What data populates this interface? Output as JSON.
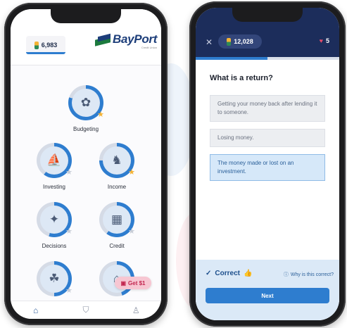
{
  "left_phone": {
    "header": {
      "coins": "6,983",
      "brand_name": "BayPort",
      "brand_sub": "Credit Union"
    },
    "topics": [
      {
        "label": "Budgeting",
        "icon": "piggy-bank-icon",
        "glyph": "✿",
        "star": "gold",
        "progress_pct": 80
      },
      {
        "label": "Investing",
        "icon": "ship-icon",
        "glyph": "⛵",
        "star": "grey",
        "progress_pct": 60
      },
      {
        "label": "Income",
        "icon": "elephant-icon",
        "glyph": "♞",
        "star": "gold",
        "progress_pct": 75
      },
      {
        "label": "Decisions",
        "icon": "bird-icon",
        "glyph": "✦",
        "star": "grey",
        "progress_pct": 55
      },
      {
        "label": "Credit",
        "icon": "building-icon",
        "glyph": "▦",
        "star": "grey",
        "progress_pct": 60
      },
      {
        "label": "",
        "icon": "chicken-icon",
        "glyph": "☘",
        "star": "grey",
        "progress_pct": 50
      },
      {
        "label": "",
        "icon": "house-icon",
        "glyph": "⌂",
        "star": "grey",
        "progress_pct": 45
      }
    ],
    "get_pill": "Get $1",
    "nav": [
      "home-icon",
      "shield-icon",
      "profile-icon"
    ]
  },
  "right_phone": {
    "header": {
      "close": "✕",
      "coins": "12,028",
      "hearts": "5"
    },
    "progress_fraction": 0.5,
    "question": "What is a return?",
    "options": [
      {
        "text": "Getting your money back after lending it to someone.",
        "state": "default"
      },
      {
        "text": "Losing money.",
        "state": "default"
      },
      {
        "text": "The money made or lost on an investment.",
        "state": "correct"
      }
    ],
    "feedback": {
      "result": "Correct",
      "why": "Why is this correct?",
      "next": "Next"
    }
  },
  "colors": {
    "brand_blue": "#1d3e7a",
    "brand_green": "#1c7a3e",
    "accent": "#2e7dcf",
    "header_navy": "#1c2d5b"
  }
}
